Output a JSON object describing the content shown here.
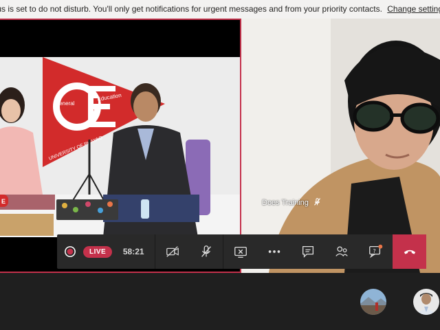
{
  "banner": {
    "text": "tus is set to do not disturb. You'll only get notifications for urgent messages and from your priority contacts.",
    "link": "Change settings."
  },
  "participant": {
    "name": "Does Training"
  },
  "controls": {
    "live_label": "LIVE",
    "timer": "58:21"
  },
  "set": {
    "logo_big": "GE",
    "logo_small_1": "General",
    "logo_small_2": "Education",
    "logo_bottom": "UNIVERSITY OF PHAYAO",
    "side_badge": "E"
  },
  "colors": {
    "live_red": "#c4314b",
    "toolbar": "#292929",
    "banner_bg": "#f3f2f1",
    "notify_dot": "#e97548"
  }
}
